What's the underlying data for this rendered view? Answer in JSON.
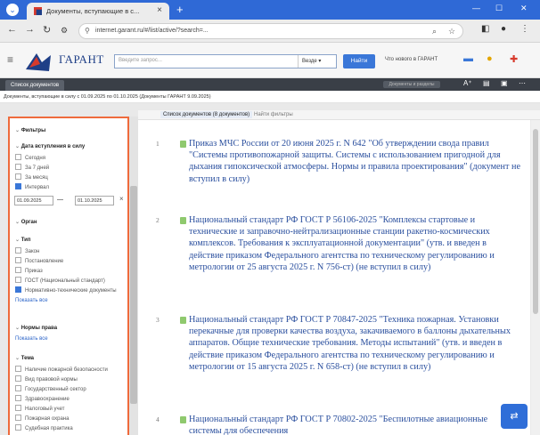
{
  "browser": {
    "tab_title": "Документы, вступающие в с...",
    "url": "internet.garant.ru/#/list/active/?search=...",
    "new_tab": "+",
    "close_tab": "×",
    "win_min": "—",
    "win_max": "☐",
    "win_close": "✕"
  },
  "header": {
    "logo": "ГАРАНТ",
    "search_placeholder": "Введите запрос...",
    "search_filter": "Везде",
    "search_button": "Найти",
    "link": "Что нового в ГАРАНТ"
  },
  "subbar": {
    "tab": "Список документов",
    "middle": "Документы и разделы"
  },
  "doc_path": "Документы, вступающие в силу с 01.09.2025 по 01.10.2025 (Документы ГАРАНТ 9.09.2025)",
  "results_tabs": {
    "active": "Список документов (8 документов)",
    "other": "Найти фильтры"
  },
  "filters": {
    "title": "Фильтры",
    "date_group": "Дата вступления в силу",
    "date_options": [
      "Сегодня",
      "За 7 дней",
      "За месяц",
      "Интервал"
    ],
    "date_from": "01.09.2025",
    "date_to": "01.10.2025",
    "organ_group": "Орган",
    "type_group": "Тип",
    "type_options": [
      "Закон",
      "Постановление",
      "Приказ",
      "ГОСТ (Национальный стандарт)",
      "Нормативно-технические документы"
    ],
    "show_all": "Показать все",
    "norm_group": "Нормы права",
    "norm_link": "Показать все",
    "topic_group": "Тема",
    "topic_options": [
      "Наличие пожарной безопасности",
      "Вид правовой нормы",
      "Государственный сектор",
      "Здравоохранение",
      "Налоговый учет",
      "Пожарная охрана",
      "Судебная практика"
    ]
  },
  "results": [
    {
      "num": "1",
      "text": "Приказ МЧС России от 20 июня 2025 г. N 642 \"Об утверждении свода правил \"Системы противопожарной защиты. Системы с использованием пригодной для дыхания гипоксической атмосферы. Нормы и правила проектирования\" (документ не вступил в силу)"
    },
    {
      "num": "2",
      "text": "Национальный стандарт РФ ГОСТ Р 56106-2025 \"Комплексы стартовые и технические и заправочно-нейтрализационные станции ракетно-космических комплексов. Требования к эксплуатационной документации\" (утв. и введен в действие приказом Федерального агентства по техническому регулированию и метрологии от 25 августа 2025 г. N 756-ст) (не вступил в силу)"
    },
    {
      "num": "3",
      "text": "Национальный стандарт РФ ГОСТ Р 70847-2025 \"Техника пожарная. Установки перекачные для проверки качества воздуха, закачиваемого в баллоны дыхательных аппаратов. Общие технические требования. Методы испытаний\" (утв. и введен в действие приказом Федерального агентства по техническому регулированию и метрологии от 15 августа 2025 г. N 658-ст) (не вступил в силу)"
    },
    {
      "num": "4",
      "text": "Национальный стандарт РФ ГОСТ Р 70802-2025 \"Беспилотные авиационные системы для обеспечения"
    }
  ]
}
